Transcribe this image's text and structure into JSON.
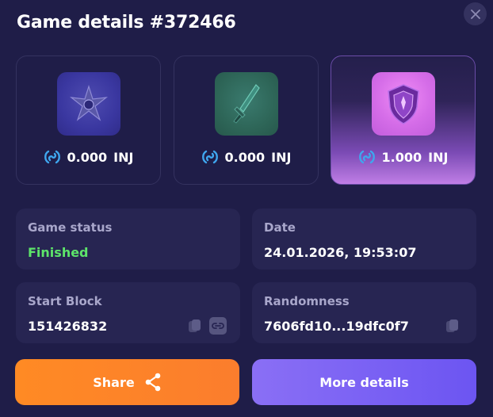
{
  "header": {
    "title": "Game details #372466"
  },
  "cards": [
    {
      "amount": "0.000",
      "unit": "INJ",
      "icon": "shuriken-icon"
    },
    {
      "amount": "0.000",
      "unit": "INJ",
      "icon": "sword-icon"
    },
    {
      "amount": "1.000",
      "unit": "INJ",
      "icon": "shield-icon"
    }
  ],
  "info": {
    "status_label": "Game status",
    "status_value": "Finished",
    "date_label": "Date",
    "date_value": "24.01.2026, 19:53:07",
    "start_block_label": "Start Block",
    "start_block_value": "151426832",
    "randomness_label": "Randomness",
    "randomness_value": "7606fd10...19dfc0f7"
  },
  "actions": {
    "share_label": "Share",
    "more_label": "More details"
  },
  "colors": {
    "background": "#1f1d48",
    "status_green": "#5de46a",
    "share": "#ff8a24",
    "more": "#7a62f3"
  }
}
